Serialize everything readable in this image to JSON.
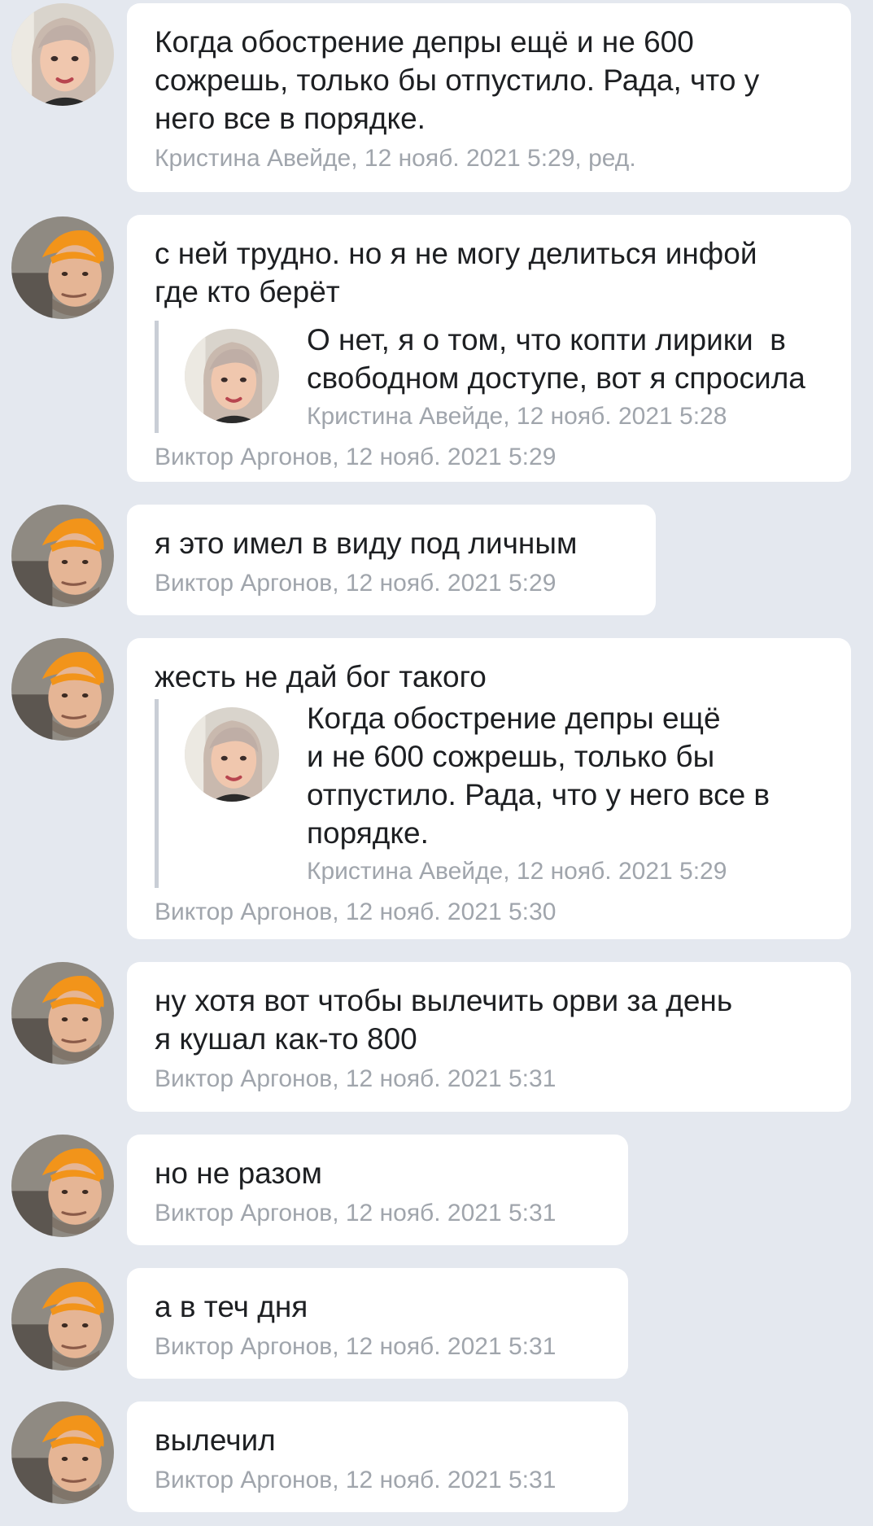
{
  "messages": [
    {
      "avatar": "female-avatar",
      "text": "Когда обострение депры ещё и не 600\nсожрешь, только бы отпустило. Рада, что у\nнего все в порядке.",
      "meta": "Кристина Авейде, 12 нояб. 2021 5:29, ред."
    },
    {
      "avatar": "male-avatar",
      "text": "с ней трудно. но я не могу делиться инфой\nгде кто берёт",
      "quote": {
        "avatar": "female-avatar",
        "text": "О нет, я о том, что копти лирики  в\nсвободном доступе, вот я спросила",
        "meta": "Кристина Авейде, 12 нояб. 2021 5:28"
      },
      "meta": "Виктор Аргонов, 12 нояб. 2021 5:29"
    },
    {
      "avatar": "male-avatar",
      "text": "я это имел в виду под личным",
      "meta": "Виктор Аргонов, 12 нояб. 2021 5:29"
    },
    {
      "avatar": "male-avatar",
      "text": "жесть не дай бог такого",
      "quote": {
        "avatar": "female-avatar",
        "text": "Когда обострение депры ещё\nи не 600 сожрешь, только бы\nотпустило. Рада, что у него все в\nпорядке.",
        "meta": "Кристина Авейде, 12 нояб. 2021 5:29"
      },
      "meta": "Виктор Аргонов, 12 нояб. 2021 5:30"
    },
    {
      "avatar": "male-avatar",
      "text": "ну хотя вот чтобы вылечить орви за день\nя кушал как-то 800",
      "meta": "Виктор Аргонов, 12 нояб. 2021 5:31"
    },
    {
      "avatar": "male-avatar",
      "text": "но не разом",
      "meta": "Виктор Аргонов, 12 нояб. 2021 5:31"
    },
    {
      "avatar": "male-avatar",
      "text": "а в теч дня",
      "meta": "Виктор Аргонов, 12 нояб. 2021 5:31"
    },
    {
      "avatar": "male-avatar",
      "text": "вылечил",
      "meta": "Виктор Аргонов, 12 нояб. 2021 5:31"
    }
  ]
}
